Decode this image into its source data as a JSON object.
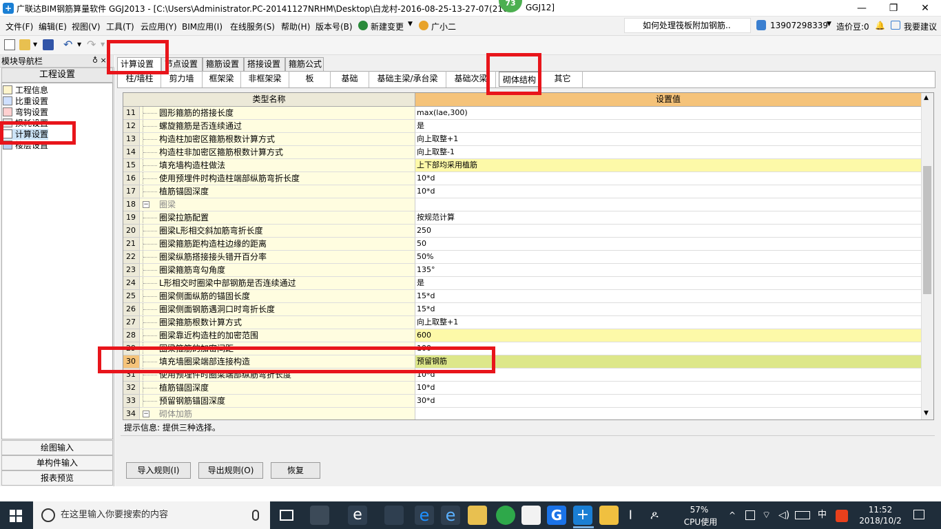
{
  "window": {
    "title": "广联达BIM钢筋算量软件 GGJ2013 - [C:\\Users\\Administrator.PC-20141127NRHM\\Desktop\\白龙村-2016-08-25-13-27-07(216",
    "title_tail": "GGJ12]",
    "badge": "73",
    "minimize": "—",
    "restore": "❐",
    "close": "✕"
  },
  "menu": {
    "items": [
      "文件(F)",
      "编辑(E)",
      "视图(V)",
      "工具(T)",
      "云应用(Y)",
      "BIM应用(I)",
      "在线服务(S)",
      "帮助(H)",
      "版本号(B)",
      "新建变更",
      "广小二"
    ],
    "hint": "如何处理筏板附加钢筋..",
    "phone": "13907298339",
    "beans": "造价豆:0",
    "suggest": "我要建议"
  },
  "nav": {
    "title": "模块导航栏",
    "pin": "♁ ×",
    "header": "工程设置",
    "tree": [
      "工程信息",
      "比重设置",
      "弯钩设置",
      "损耗设置",
      "计算设置",
      "楼层设置"
    ],
    "bottom": [
      "绘图输入",
      "单构件输入",
      "报表预览"
    ]
  },
  "tabs": [
    "计算设置",
    "节点设置",
    "箍筋设置",
    "搭接设置",
    "箍筋公式"
  ],
  "subtabs": [
    "柱/墙柱",
    "剪力墙",
    "框架梁",
    "非框架梁",
    "板",
    "基础",
    "基础主梁/承台梁",
    "基础次梁",
    "砌体结构",
    "其它"
  ],
  "grid": {
    "col_name": "类型名称",
    "col_value": "设置值",
    "rows": [
      {
        "n": "11",
        "name": "圆形箍筋的搭接长度",
        "value": "max(lae,300)"
      },
      {
        "n": "12",
        "name": "螺旋箍筋是否连续通过",
        "value": "是"
      },
      {
        "n": "13",
        "name": "构造柱加密区箍筋根数计算方式",
        "value": "向上取整+1"
      },
      {
        "n": "14",
        "name": "构造柱非加密区箍筋根数计算方式",
        "value": "向上取整-1"
      },
      {
        "n": "15",
        "name": "填充墙构造柱做法",
        "value": "上下部均采用植筋"
      },
      {
        "n": "16",
        "name": "使用预埋件时构造柱端部纵筋弯折长度",
        "value": "10*d"
      },
      {
        "n": "17",
        "name": "植筋锚固深度",
        "value": "10*d"
      },
      {
        "n": "18",
        "name": "圈梁",
        "value": ""
      },
      {
        "n": "19",
        "name": "圈梁拉筋配置",
        "value": "按规范计算"
      },
      {
        "n": "20",
        "name": "圈梁L形相交斜加筋弯折长度",
        "value": "250"
      },
      {
        "n": "21",
        "name": "圈梁箍筋距构造柱边缘的距离",
        "value": "50"
      },
      {
        "n": "22",
        "name": "圈梁纵筋搭接接头错开百分率",
        "value": "50%"
      },
      {
        "n": "23",
        "name": "圈梁箍筋弯勾角度",
        "value": "135°"
      },
      {
        "n": "24",
        "name": "L形相交时圈梁中部钢筋是否连续通过",
        "value": "是"
      },
      {
        "n": "25",
        "name": "圈梁侧面纵筋的锚固长度",
        "value": "15*d"
      },
      {
        "n": "26",
        "name": "圈梁侧面钢筋遇洞口时弯折长度",
        "value": "15*d"
      },
      {
        "n": "27",
        "name": "圈梁箍筋根数计算方式",
        "value": "向上取整+1"
      },
      {
        "n": "28",
        "name": "圈梁靠近构造柱的加密范围",
        "value": "600"
      },
      {
        "n": "29",
        "name": "圈梁箍筋的加密间距",
        "value": "100"
      },
      {
        "n": "30",
        "name": "填充墙圈梁端部连接构造",
        "value": "预留钢筋"
      },
      {
        "n": "31",
        "name": "使用预埋件时圈梁端部纵筋弯折长度",
        "value": "10*d"
      },
      {
        "n": "32",
        "name": "植筋锚固深度",
        "value": "10*d"
      },
      {
        "n": "33",
        "name": "预留钢筋锚固深度",
        "value": "30*d"
      },
      {
        "n": "34",
        "name": "砌体加筋",
        "value": ""
      }
    ]
  },
  "hint": "提示信息: 提供三种选择。",
  "buttons": {
    "import": "导入规则(I)",
    "export": "导出规则(O)",
    "restore": "恢复"
  },
  "taskbar": {
    "search_placeholder": "在这里输入你要搜索的内容",
    "cpu_pct": "57%",
    "cpu_label": "CPU使用",
    "ime": "中",
    "time": "11:52",
    "date": "2018/10/2"
  }
}
